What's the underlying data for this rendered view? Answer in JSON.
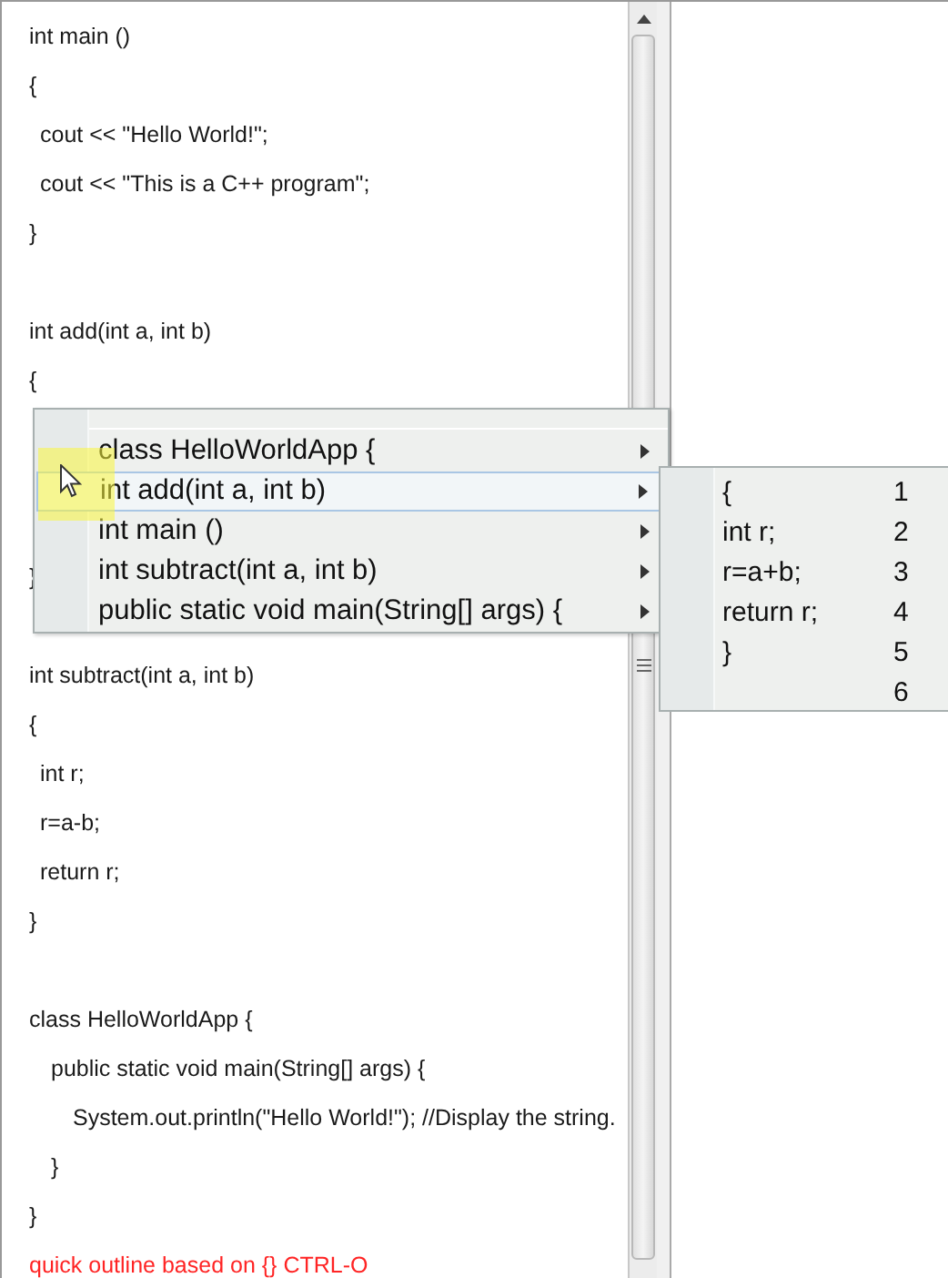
{
  "editor": {
    "code_blocks": [
      {
        "kind": "cpp",
        "lines": [
          {
            "text": "int main ()"
          },
          {
            "text": "{",
            "children": [
              {
                "text": "cout << \"Hello World!\";"
              },
              {
                "text": "cout << \"This is a C++ program\";"
              }
            ]
          },
          {
            "text": "}"
          }
        ]
      },
      {
        "kind": "cpp_covered",
        "lines": [
          {
            "text": "int add(int a, int b)"
          },
          {
            "text": "{"
          },
          {
            "text": "}"
          }
        ]
      },
      {
        "kind": "cpp",
        "lines": [
          {
            "text": "int subtract(int a, int b)"
          },
          {
            "text": "{",
            "children": [
              {
                "text": "int r;"
              },
              {
                "text": "r=a-b;"
              },
              {
                "text": "return r;"
              }
            ]
          },
          {
            "text": "}"
          }
        ]
      },
      {
        "kind": "java",
        "lines": [
          {
            "text": "class HelloWorldApp {",
            "children": [
              {
                "text": "public static void main(String[] args) {",
                "children": [
                  {
                    "text": "System.out.println(\"Hello World!\"); //Display the string."
                  }
                ]
              },
              {
                "text": "}"
              }
            ]
          },
          {
            "text": "}"
          }
        ]
      }
    ],
    "hint": "quick outline based on {} CTRL-O"
  },
  "outline_popup": {
    "items": [
      {
        "label": "class HelloWorldApp {",
        "selected": false
      },
      {
        "label": "int add(int a, int b)",
        "selected": true
      },
      {
        "label": "int main ()",
        "selected": false
      },
      {
        "label": "int subtract(int a, int b)",
        "selected": false
      },
      {
        "label": "public static void main(String[] args) {",
        "selected": false
      }
    ],
    "submenu": {
      "rows": [
        {
          "code": "{",
          "line": "1"
        },
        {
          "code": "int r;",
          "line": "2"
        },
        {
          "code": "r=a+b;",
          "line": "3"
        },
        {
          "code": "return r;",
          "line": "4"
        },
        {
          "code": "}",
          "line": "5"
        },
        {
          "line": "6"
        }
      ]
    }
  }
}
